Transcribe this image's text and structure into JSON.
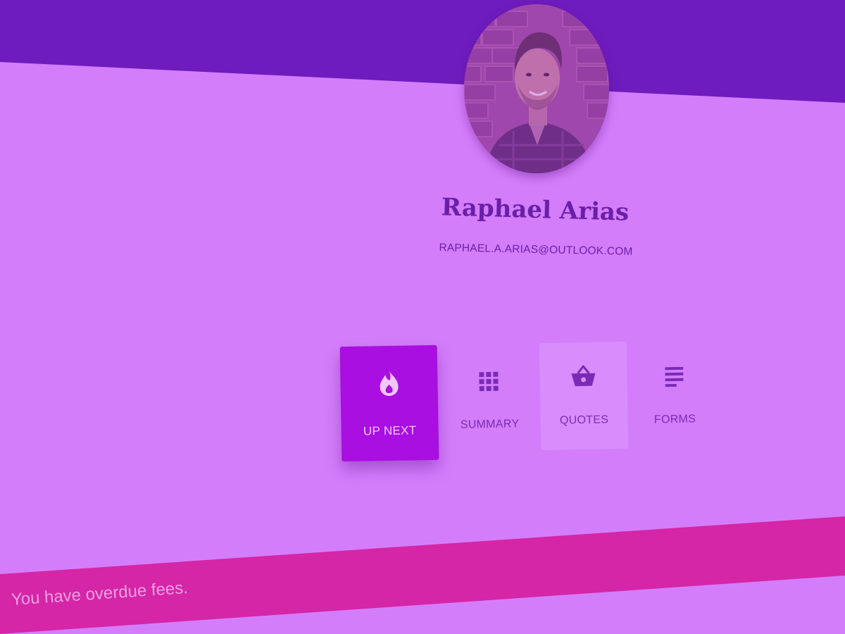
{
  "profile": {
    "name": "Raphael Arias",
    "email": "RAPHAEL.A.ARIAS@OUTLOOK.COM",
    "avatar_icon": "profile-photo"
  },
  "tabs": [
    {
      "label": "UP NEXT",
      "icon": "flame-icon",
      "active": true
    },
    {
      "label": "SUMMARY",
      "icon": "grid-icon",
      "active": false
    },
    {
      "label": "QUOTES",
      "icon": "basket-icon",
      "active": false
    },
    {
      "label": "FORMS",
      "icon": "notes-icon",
      "active": false
    }
  ],
  "alert": {
    "message": "You have overdue fees."
  },
  "colors": {
    "background": "#d47dfb",
    "header": "#6e1cbe",
    "accent": "#a80fe0",
    "alert": "#d426a6",
    "text": "#6a1fa8"
  }
}
